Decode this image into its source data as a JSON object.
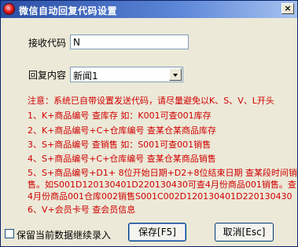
{
  "window": {
    "title": "微信自动回复代码设置",
    "close_label": "×"
  },
  "form": {
    "receive_code_label": "接收代码",
    "receive_code_value": "N",
    "reply_content_label": "回复内容",
    "reply_content_value": "新闻1"
  },
  "notes": {
    "warning": "注意：系统已自带设置发送代码，请尽量避免以K、S、V、L开头",
    "lines": [
      "1、K+商品编号 查库存   如：K001可查001库存",
      "2、K+商品编号+C+仓库编号 查某仓某商品库存",
      "3、S+商品编号 查销售   如：S001可查001销售",
      "4、S+商品编号+C+仓库编号 查某仓某商品销售",
      "5、S+商品编号+D1+ 8位开始日期+D2+8位结束日期 查某段时间销售。如S001D120130401D220130430可查4月份商品001销售。查4月份商品001仓库002销售S001C002D120130401D220130430",
      "6、V+会员卡号  查会员信息"
    ]
  },
  "footer": {
    "keep_data_label": "保留当前数据继续录入",
    "keep_data_checked": false,
    "save_label": "保存[F5]",
    "cancel_label": "取消[Esc]"
  }
}
